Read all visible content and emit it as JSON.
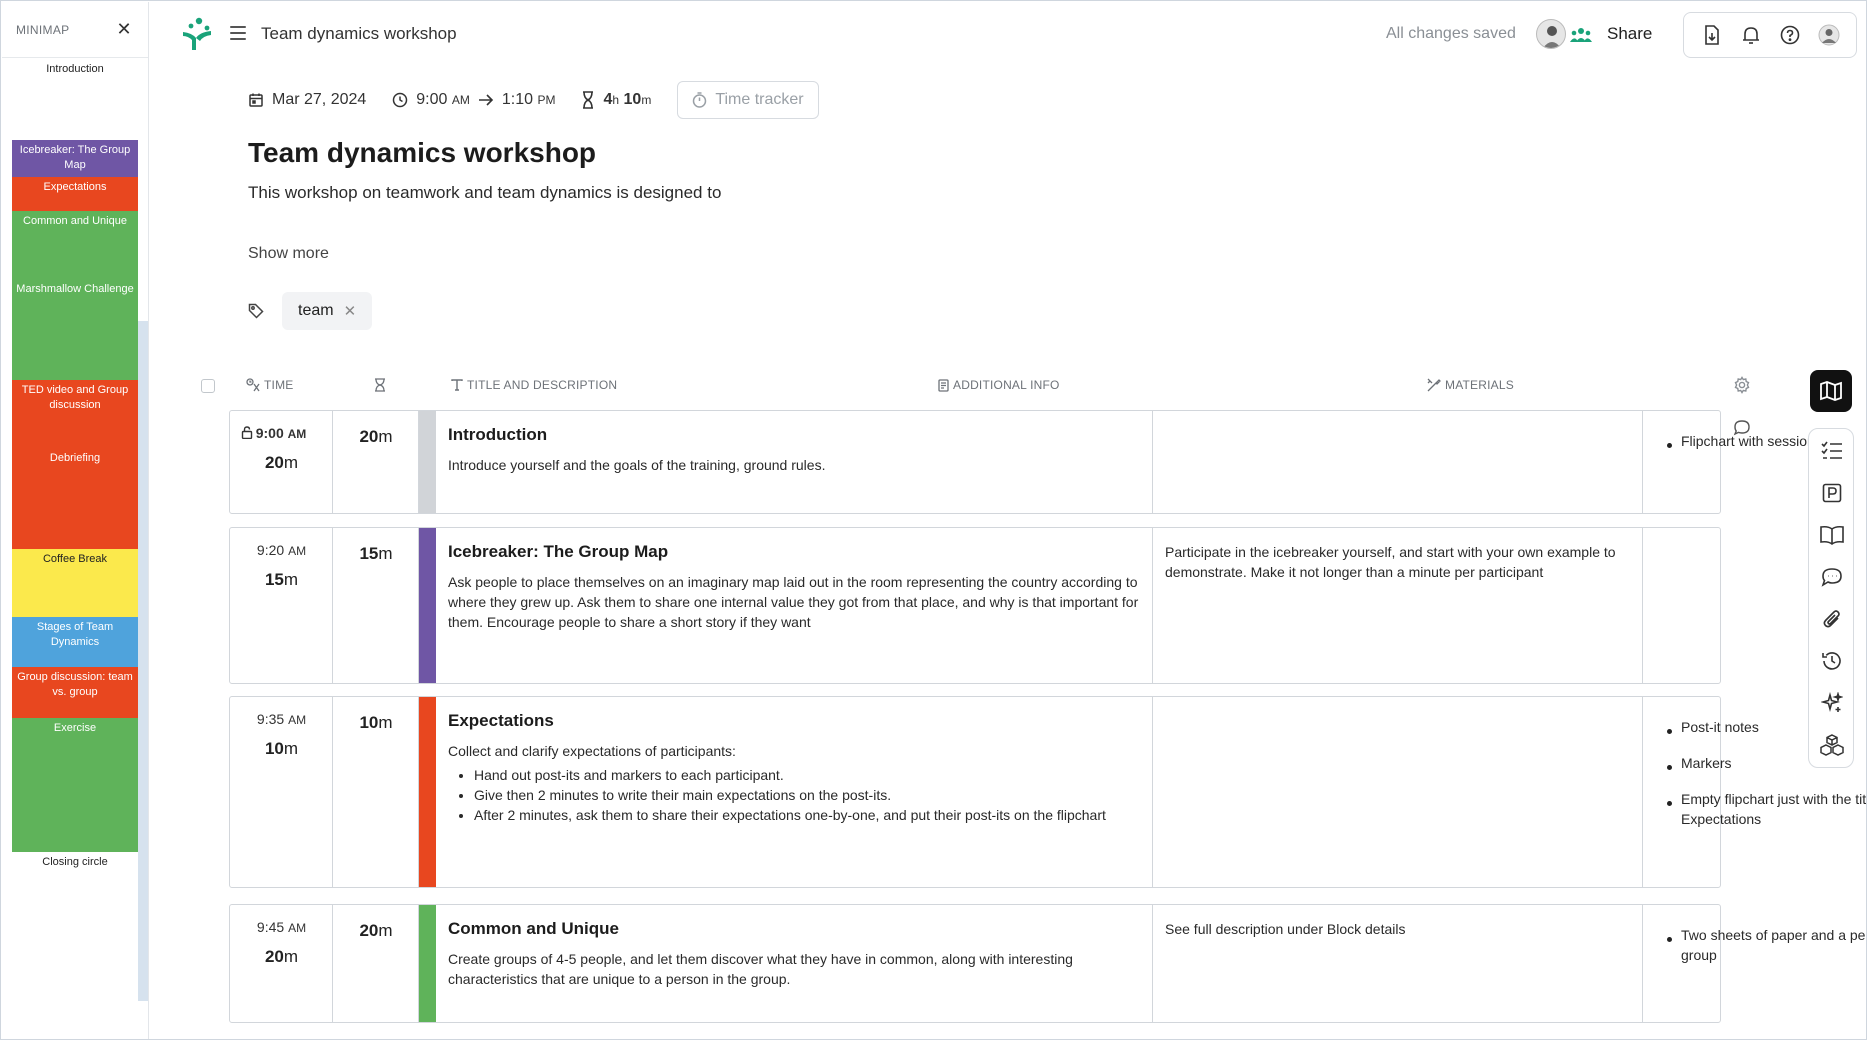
{
  "minimap": {
    "title": "MINIMAP",
    "close_glyph": "✕",
    "blocks": [
      {
        "label": "Introduction",
        "color": "#ffffff",
        "text_color": "#222222"
      },
      {
        "label": "Icebreaker: The Group Map",
        "color": "#6f56a5",
        "text_color": "#ffffff"
      },
      {
        "label": "Expectations",
        "color": "#e8471f",
        "text_color": "#ffffff"
      },
      {
        "label": "Common and Unique",
        "color": "#5fb35a",
        "text_color": "#ffffff"
      },
      {
        "label": "Marshmallow Challenge",
        "color": "#5fb35a",
        "text_color": "#ffffff"
      },
      {
        "label": "TED video and Group discussion",
        "color": "#e8471f",
        "text_color": "#ffffff"
      },
      {
        "label": "Debriefing",
        "color": "#e8471f",
        "text_color": "#ffffff"
      },
      {
        "label": "Coffee Break",
        "color": "#fbe94c",
        "text_color": "#222222"
      },
      {
        "label": "Stages of Team Dynamics",
        "color": "#4fa3dc",
        "text_color": "#ffffff"
      },
      {
        "label": "Group discussion: team vs. group",
        "color": "#e8471f",
        "text_color": "#ffffff"
      },
      {
        "label": "Exercise",
        "color": "#5fb35a",
        "text_color": "#ffffff"
      },
      {
        "label": "Closing circle",
        "color": "#ffffff",
        "text_color": "#222222"
      }
    ]
  },
  "header": {
    "doc_title": "Team dynamics workshop",
    "saved_status": "All changes saved",
    "share_label": "Share",
    "brand_color": "#1aa37a"
  },
  "meta": {
    "date": "Mar 27, 2024",
    "start_time": "9:00",
    "start_ampm": "AM",
    "end_time": "1:10",
    "end_ampm": "PM",
    "duration_h": "4",
    "duration_h_unit": "h",
    "duration_m": "10",
    "duration_m_unit": "m",
    "time_tracker_label": "Time tracker"
  },
  "session": {
    "title": "Team dynamics workshop",
    "description": "This workshop on teamwork and team dynamics is designed to",
    "show_more_label": "Show more",
    "tags": [
      "team"
    ]
  },
  "table": {
    "columns": {
      "time": "TIME",
      "title": "TITLE AND DESCRIPTION",
      "info": "ADDITIONAL INFO",
      "materials": "MATERIALS"
    },
    "rows": [
      {
        "start": "9:00",
        "ampm": "AM",
        "duration": "20",
        "unit": "m",
        "locked": true,
        "color": "#d1d4d8",
        "title": "Introduction",
        "description": "Introduce yourself and the goals of the training, ground rules.",
        "bullets": [],
        "info": "",
        "materials": [
          "Flipchart with session goals"
        ]
      },
      {
        "start": "9:20",
        "ampm": "AM",
        "duration": "15",
        "unit": "m",
        "locked": false,
        "color": "#6f56a5",
        "title": "Icebreaker: The Group Map",
        "description": "Ask people to place themselves on an imaginary map laid out in the room representing the country according to where they grew up. Ask them to share one internal value they got from that place, and why is that important for them. Encourage people to share a short story if they want",
        "bullets": [],
        "info": "Participate in the icebreaker yourself, and start with your own example to demonstrate. Make it not longer than a minute per participant",
        "materials": []
      },
      {
        "start": "9:35",
        "ampm": "AM",
        "duration": "10",
        "unit": "m",
        "locked": false,
        "color": "#e8471f",
        "title": "Expectations",
        "description": "Collect and clarify expectations of participants:",
        "bullets": [
          "Hand out post-its and markers to each participant.",
          "Give then 2 minutes to write their main expectations on the post-its.",
          "After 2 minutes, ask them to share their expectations one-by-one, and put their post-its on the flipchart"
        ],
        "info": "",
        "materials": [
          "Post-it notes",
          "Markers",
          "Empty flipchart just with the title: Expectations"
        ]
      },
      {
        "start": "9:45",
        "ampm": "AM",
        "duration": "20",
        "unit": "m",
        "locked": false,
        "color": "#5fb35a",
        "title": "Common and Unique",
        "description": "Create groups of 4-5 people, and let them discover what they have in common, along with interesting characteristics that are unique to a person in the group.",
        "bullets": [],
        "info": "See full description under Block details",
        "materials": [
          "Two sheets of paper and a pen for each group"
        ]
      }
    ]
  }
}
